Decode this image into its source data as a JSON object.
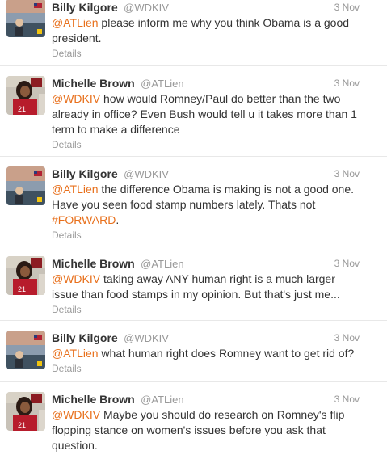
{
  "tweets": [
    {
      "user": "billy",
      "name": "Billy Kilgore",
      "handle": "@WDKIV",
      "time": "3 Nov",
      "mention": "@ATLien",
      "text": " please inform me why you think Obama is a good president.",
      "details": "Details"
    },
    {
      "user": "michelle",
      "name": "Michelle Brown",
      "handle": "@ATLien",
      "time": "3 Nov",
      "mention": "@WDKIV",
      "text": " how would Romney/Paul do better than the two already in office? Even Bush would tell u it takes more than 1 term to make a difference",
      "details": "Details"
    },
    {
      "user": "billy",
      "name": "Billy Kilgore",
      "handle": "@WDKIV",
      "time": "3 Nov",
      "mention": "@ATLien",
      "text": " the difference Obama is making is not a good one. Have you seen food stamp numbers lately. Thats not ",
      "hashtag": "#FORWARD",
      "text_after": ".",
      "details": "Details"
    },
    {
      "user": "michelle",
      "name": "Michelle Brown",
      "handle": "@ATLien",
      "time": "3 Nov",
      "mention": "@WDKIV",
      "text": " taking away ANY human right is a much larger issue than food stamps in my opinion. But that's just me...",
      "details": "Details"
    },
    {
      "user": "billy",
      "name": "Billy Kilgore",
      "handle": "@WDKIV",
      "time": "3 Nov",
      "mention": "@ATLien",
      "text": " what human right does Romney want to get rid of?",
      "details": "Details"
    },
    {
      "user": "michelle",
      "name": "Michelle Brown",
      "handle": "@ATLien",
      "time": "3 Nov",
      "mention": "@WDKIV",
      "text": " Maybe you should do research on Romney's flip flopping stance on women's issues before you ask that question."
    }
  ],
  "colors": {
    "link": "#e8701c",
    "muted": "#999999",
    "text": "#333333"
  }
}
